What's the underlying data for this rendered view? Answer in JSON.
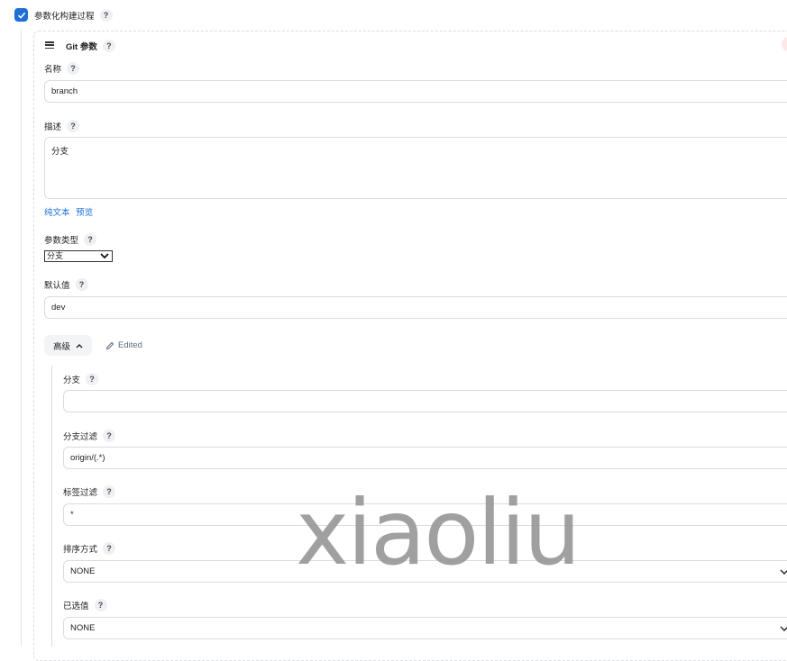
{
  "parameterized": {
    "label": "参数化构建过程",
    "help": "?"
  },
  "git_param": {
    "header": "Git 参数",
    "help": "?",
    "name": {
      "label": "名称",
      "help": "?",
      "value": "branch"
    },
    "description": {
      "label": "描述",
      "help": "?",
      "value": "分支"
    },
    "format_links": {
      "plain": "纯文本",
      "preview": "预览"
    },
    "param_type": {
      "label": "参数类型",
      "help": "?",
      "selected": "分支"
    },
    "default_value": {
      "label": "默认值",
      "help": "?",
      "value": "dev"
    },
    "advanced": {
      "label": "高级",
      "edited": "Edited"
    },
    "branch": {
      "label": "分支",
      "help": "?",
      "value": ""
    },
    "branch_filter": {
      "label": "分支过滤",
      "help": "?",
      "value": "origin/(.*)"
    },
    "tag_filter": {
      "label": "标签过滤",
      "help": "?",
      "value": "*"
    },
    "sort_mode": {
      "label": "排序方式",
      "help": "?",
      "selected": "NONE"
    },
    "selected_value": {
      "label": "已选值",
      "help": "?",
      "selected": "NONE"
    }
  },
  "watermark": "xiaoliu",
  "colors": {
    "accent": "#1f6fd6",
    "link": "#1f6fd6",
    "edited": "#5c6a80",
    "watermark": "#9b9b9b"
  }
}
